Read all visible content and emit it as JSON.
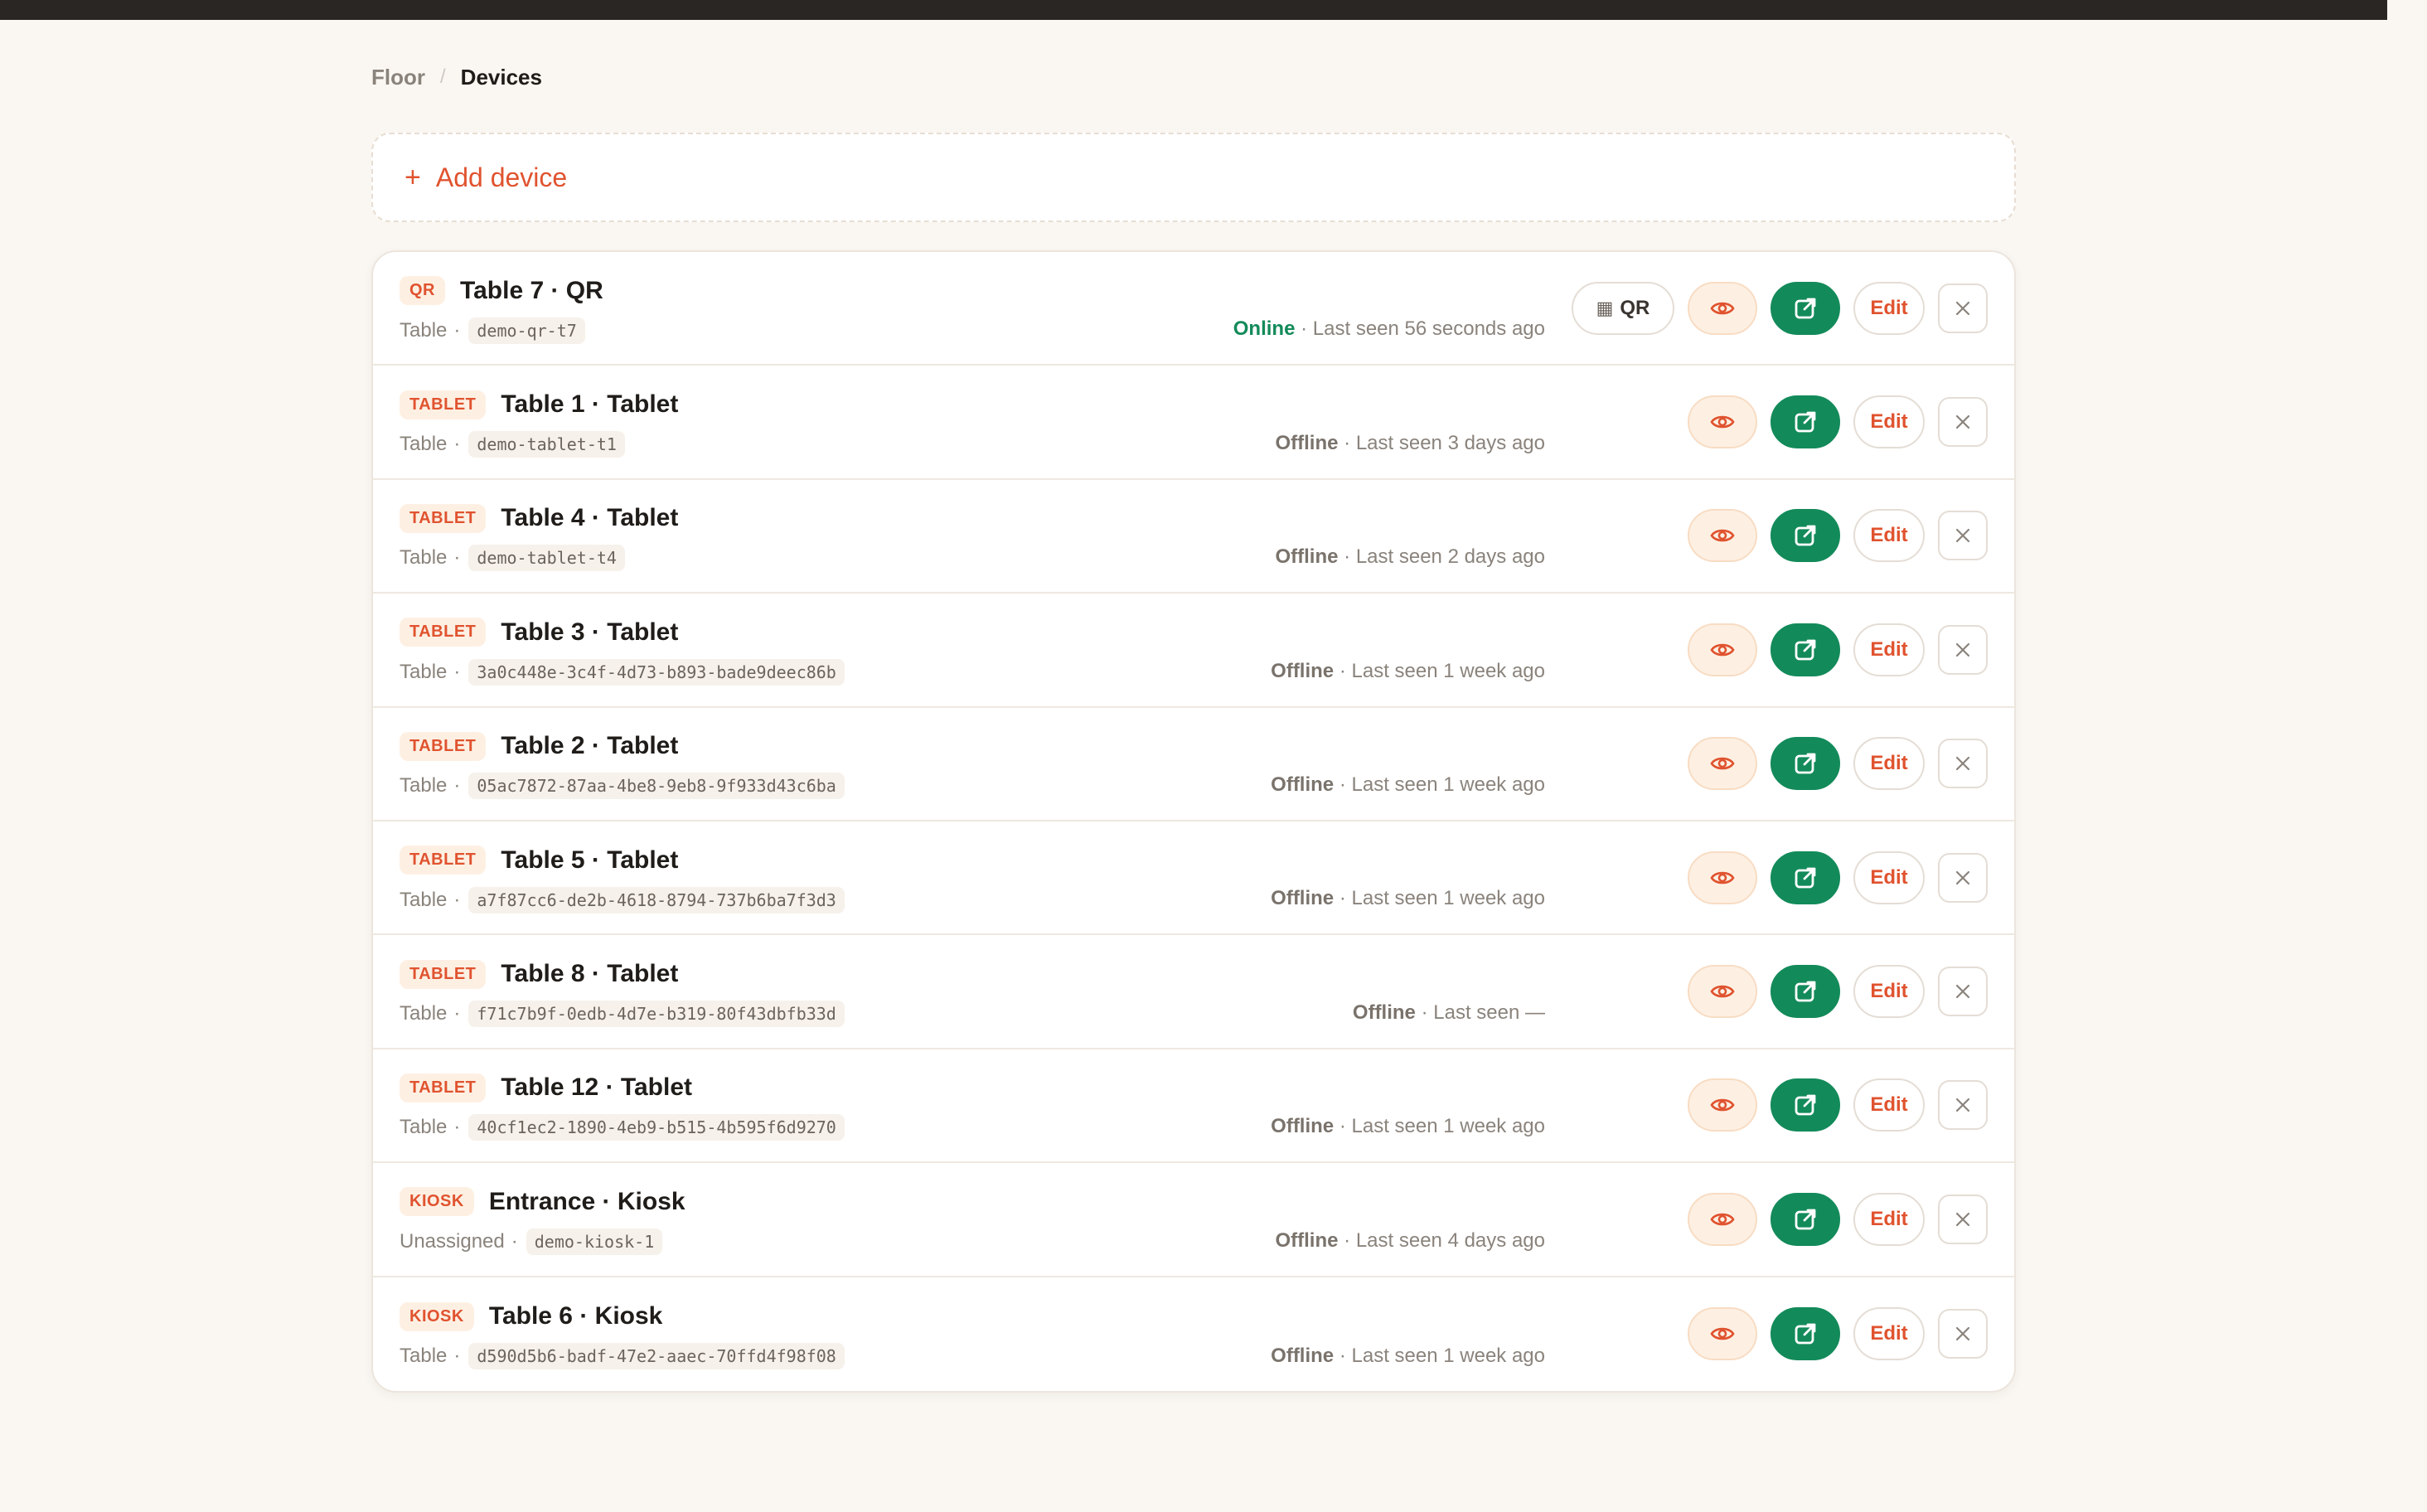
{
  "breadcrumb": {
    "parent": "Floor",
    "separator": "/",
    "current": "Devices"
  },
  "add_device": {
    "plus": "+",
    "label": "Add device"
  },
  "actions": {
    "qr_label": "QR",
    "edit_label": "Edit",
    "icons": [
      "grid-icon",
      "eye-icon",
      "external-link-icon",
      "close-icon"
    ]
  },
  "colors": {
    "accent": "#e0532f",
    "online": "#138a5a",
    "open_button": "#138a5a",
    "badge_bg": "#fdf0e3",
    "background": "#faf7f2"
  },
  "devices": [
    {
      "badge": "QR",
      "title": "Table 7 · QR",
      "type": "Table",
      "code": "demo-qr-t7",
      "status": "Online",
      "last_seen": "Last seen 56 seconds ago",
      "online": true,
      "has_qr": true
    },
    {
      "badge": "TABLET",
      "title": "Table 1 · Tablet",
      "type": "Table",
      "code": "demo-tablet-t1",
      "status": "Offline",
      "last_seen": "Last seen 3 days ago",
      "online": false,
      "has_qr": false
    },
    {
      "badge": "TABLET",
      "title": "Table 4 · Tablet",
      "type": "Table",
      "code": "demo-tablet-t4",
      "status": "Offline",
      "last_seen": "Last seen 2 days ago",
      "online": false,
      "has_qr": false
    },
    {
      "badge": "TABLET",
      "title": "Table 3 · Tablet",
      "type": "Table",
      "code": "3a0c448e-3c4f-4d73-b893-bade9deec86b",
      "status": "Offline",
      "last_seen": "Last seen 1 week ago",
      "online": false,
      "has_qr": false
    },
    {
      "badge": "TABLET",
      "title": "Table 2 · Tablet",
      "type": "Table",
      "code": "05ac7872-87aa-4be8-9eb8-9f933d43c6ba",
      "status": "Offline",
      "last_seen": "Last seen 1 week ago",
      "online": false,
      "has_qr": false
    },
    {
      "badge": "TABLET",
      "title": "Table 5 · Tablet",
      "type": "Table",
      "code": "a7f87cc6-de2b-4618-8794-737b6ba7f3d3",
      "status": "Offline",
      "last_seen": "Last seen 1 week ago",
      "online": false,
      "has_qr": false
    },
    {
      "badge": "TABLET",
      "title": "Table 8 · Tablet",
      "type": "Table",
      "code": "f71c7b9f-0edb-4d7e-b319-80f43dbfb33d",
      "status": "Offline",
      "last_seen": "Last seen —",
      "online": false,
      "has_qr": false
    },
    {
      "badge": "TABLET",
      "title": "Table 12 · Tablet",
      "type": "Table",
      "code": "40cf1ec2-1890-4eb9-b515-4b595f6d9270",
      "status": "Offline",
      "last_seen": "Last seen 1 week ago",
      "online": false,
      "has_qr": false
    },
    {
      "badge": "KIOSK",
      "title": "Entrance · Kiosk",
      "type": "Unassigned",
      "code": "demo-kiosk-1",
      "status": "Offline",
      "last_seen": "Last seen 4 days ago",
      "online": false,
      "has_qr": false
    },
    {
      "badge": "KIOSK",
      "title": "Table 6 · Kiosk",
      "type": "Table",
      "code": "d590d5b6-badf-47e2-aaec-70ffd4f98f08",
      "status": "Offline",
      "last_seen": "Last seen 1 week ago",
      "online": false,
      "has_qr": false
    }
  ]
}
